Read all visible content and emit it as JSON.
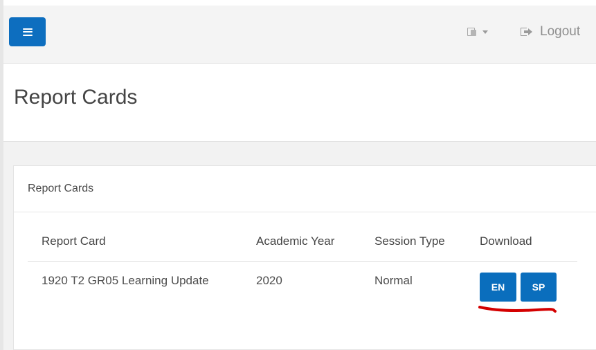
{
  "header": {
    "logout_label": "Logout",
    "menu_icon": "hamburger-menu-icon",
    "language_icon": "translate-icon",
    "logout_icon": "sign-out-icon",
    "accent_color": "#0d6ebf"
  },
  "page": {
    "title": "Report Cards"
  },
  "panel": {
    "heading": "Report Cards",
    "columns": [
      "Report Card",
      "Academic Year",
      "Session Type",
      "Download"
    ],
    "rows": [
      {
        "report_card": "1920 T2 GR05 Learning Update",
        "academic_year": "2020",
        "session_type": "Normal",
        "downloads": [
          "EN",
          "SP"
        ]
      }
    ]
  },
  "annotation": {
    "underline_color": "#d40000"
  }
}
